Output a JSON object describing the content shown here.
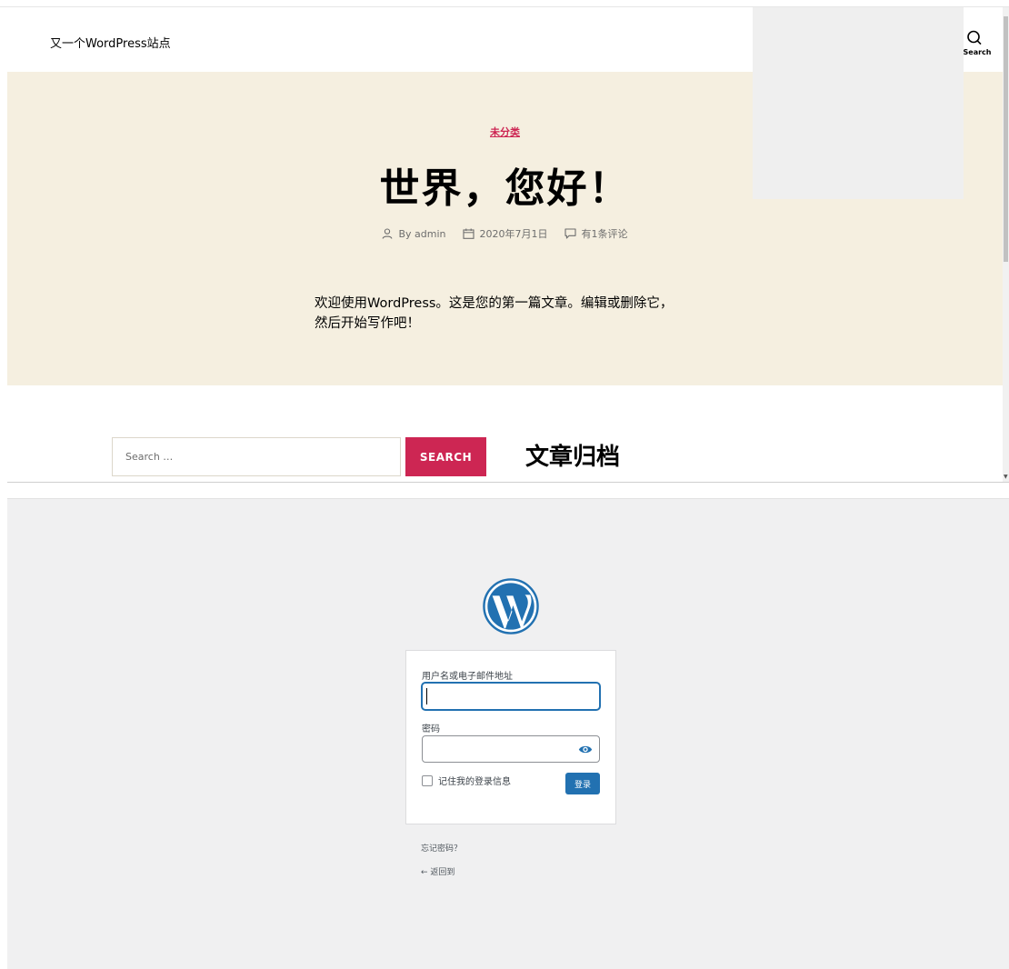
{
  "site": {
    "title": "又一个WordPress站点",
    "search_toggle_label": "Search"
  },
  "post": {
    "category": "未分类",
    "title": "世界，您好！",
    "meta": {
      "author": "By admin",
      "date": "2020年7月1日",
      "comments": "有1条评论"
    },
    "excerpt_line1": "欢迎使用WordPress。这是您的第一篇文章。编辑或删除它，",
    "excerpt_line2": "然后开始写作吧！"
  },
  "search_widget": {
    "placeholder": "Search …",
    "button_label": "SEARCH"
  },
  "archive_widget": {
    "title": "文章归档"
  },
  "login": {
    "username_label": "用户名或电子邮件地址",
    "password_label": "密码",
    "remember_label": "记住我的登录信息",
    "submit_label": "登录",
    "lost_password": "忘记密码？",
    "back_link": "← 返回到"
  },
  "colors": {
    "accent": "#cd2653",
    "hero_bg": "#f5efe0",
    "login_bg": "#f0f0f1",
    "wp_blue": "#2271b1"
  }
}
